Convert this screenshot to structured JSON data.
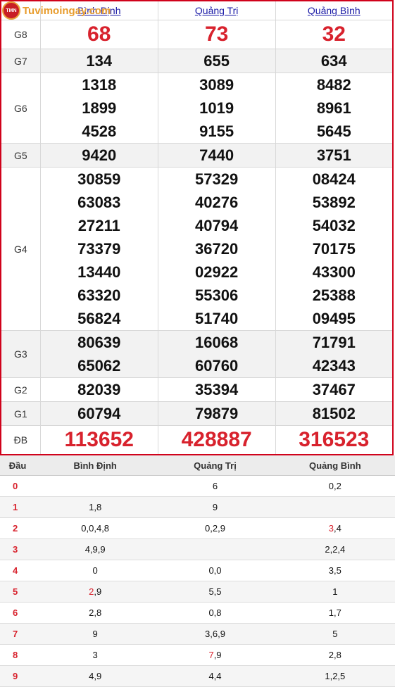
{
  "logo": {
    "mark": "TMN",
    "text": "Tuvimoingay.com"
  },
  "provinces": [
    "Bình Định",
    "Quảng Trị",
    "Quảng Bình"
  ],
  "labels": {
    "g8": "G8",
    "g7": "G7",
    "g6": "G6",
    "g5": "G5",
    "g4": "G4",
    "g3": "G3",
    "g2": "G2",
    "g1": "G1",
    "db": "ĐB"
  },
  "prizes": {
    "g8": [
      "68",
      "73",
      "32"
    ],
    "g7": [
      "134",
      "655",
      "634"
    ],
    "g6": [
      [
        "1318",
        "1899",
        "4528"
      ],
      [
        "3089",
        "1019",
        "9155"
      ],
      [
        "8482",
        "8961",
        "5645"
      ]
    ],
    "g5": [
      "9420",
      "7440",
      "3751"
    ],
    "g4": [
      [
        "30859",
        "63083",
        "27211",
        "73379",
        "13440",
        "63320",
        "56824"
      ],
      [
        "57329",
        "40276",
        "40794",
        "36720",
        "02922",
        "55306",
        "51740"
      ],
      [
        "08424",
        "53892",
        "54032",
        "70175",
        "43300",
        "25388",
        "09495"
      ]
    ],
    "g3": [
      [
        "80639",
        "65062"
      ],
      [
        "16068",
        "60760"
      ],
      [
        "71791",
        "42343"
      ]
    ],
    "g2": [
      "82039",
      "35394",
      "37467"
    ],
    "g1": [
      "60794",
      "79879",
      "81502"
    ],
    "db": [
      "113652",
      "428887",
      "316523"
    ]
  },
  "loto": {
    "head_label": "Đầu",
    "columns": [
      "Bình Định",
      "Quảng Trị",
      "Quảng Bình"
    ],
    "rows": [
      {
        "head": "0",
        "cells": [
          "",
          "6",
          "0,2"
        ]
      },
      {
        "head": "1",
        "cells": [
          "1,8",
          "9",
          ""
        ]
      },
      {
        "head": "2",
        "cells": [
          "0,0,4,8",
          "0,2,9",
          "3,4"
        ]
      },
      {
        "head": "3",
        "cells": [
          "4,9,9",
          "",
          "2,2,4"
        ]
      },
      {
        "head": "4",
        "cells": [
          "0",
          "0,0",
          "3,5"
        ]
      },
      {
        "head": "5",
        "cells": [
          "2,9",
          "5,5",
          "1"
        ]
      },
      {
        "head": "6",
        "cells": [
          "2,8",
          "0,8",
          "1,7"
        ]
      },
      {
        "head": "7",
        "cells": [
          "9",
          "3,6,9",
          "5"
        ]
      },
      {
        "head": "8",
        "cells": [
          "3",
          "7,9",
          "2,8"
        ]
      },
      {
        "head": "9",
        "cells": [
          "4,9",
          "4,4",
          "1,2,5"
        ]
      }
    ]
  },
  "highlight_color": "#d8222d"
}
